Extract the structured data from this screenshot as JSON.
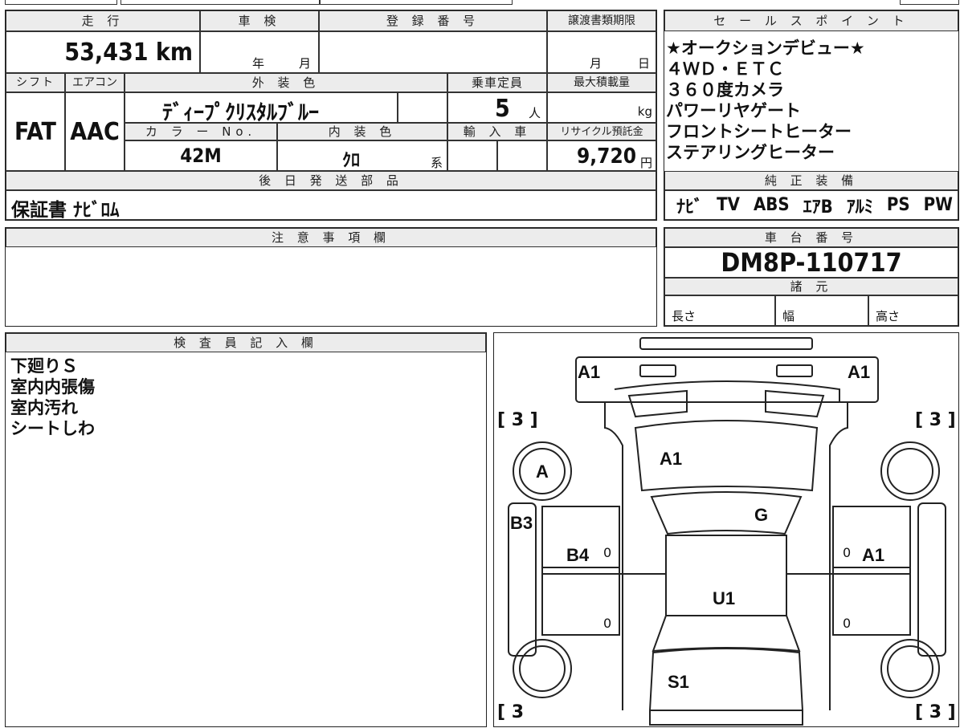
{
  "top_section": {
    "mileage_header": "走 行",
    "mileage_value": "53,431",
    "mileage_unit": "km",
    "inspection_header": "車 検",
    "inspection_year": "年",
    "inspection_month": "月",
    "registration_header": "登 録 番 号",
    "transfer_header": "譲渡書類期限",
    "transfer_month": "月",
    "transfer_day": "日",
    "shift_header": "シフト",
    "aircon_header": "エアコン",
    "exterior_header": "外 装 色",
    "capacity_header": "乗車定員",
    "maxload_header": "最大積載量",
    "shift_value": "FAT",
    "aircon_value": "AAC",
    "exterior_value": "ﾃﾞｨｰﾌﾟｸﾘｽﾀﾙﾌﾞﾙｰ",
    "capacity_value": "5",
    "capacity_unit": "人",
    "maxload_unit": "kg",
    "color_no_header": "カ ラ ー No.",
    "interior_header": "内 装 色",
    "import_header": "輸 入 車",
    "recycle_header": "リサイクル預託金",
    "color_no_value": "42M",
    "interior_value": "ｸﾛ",
    "interior_suffix": "系",
    "recycle_value": "9,720",
    "recycle_unit": "円",
    "later_parts_header": "後 日 発 送 部 品",
    "later_parts_value": "保証書 ﾅﾋﾞﾛﾑ"
  },
  "sales_points": {
    "header": "セ ー ル ス ポ イ ン ト",
    "lines": [
      "★オークションデビュー★",
      "４ＷＤ・ＥＴＣ",
      "３６０度カメラ",
      "パワーリヤゲート",
      "フロントシートヒーター",
      "ステアリングヒーター"
    ]
  },
  "standard_equipment": {
    "header": "純 正 装 備",
    "items": [
      "ﾅﾋﾞ",
      "TV",
      "ABS",
      "ｴｱB",
      "ｱﾙﾐ",
      "PS",
      "PW"
    ]
  },
  "caution": {
    "header": "注 意 事 項 欄"
  },
  "chassis": {
    "header": "車 台 番 号",
    "value": "DM8P-110717",
    "spec_header": "諸 元",
    "length_label": "長さ",
    "width_label": "幅",
    "height_label": "高さ"
  },
  "inspector": {
    "header": "検 査 員 記 入 欄",
    "lines": [
      "下廻りＳ",
      "室内内張傷",
      "室内汚れ",
      "シートしわ"
    ]
  },
  "car_map": {
    "labels": {
      "front_left": "A1",
      "front_right": "A1",
      "hood": "A1",
      "windshield": "G",
      "left_front_wheel": "A",
      "left_front_fender": "B3",
      "left_front_door": "B4",
      "right_front_door": "A1",
      "roof": "U1",
      "rear": "S1"
    },
    "tire_left_front": "[ 3 ]",
    "tire_right_front": "[ 3 ]",
    "tire_left_rear": "[ 3",
    "tire_right_rear": "[ 3 ]",
    "door_marks": [
      "0",
      "0",
      "0",
      "0"
    ]
  }
}
